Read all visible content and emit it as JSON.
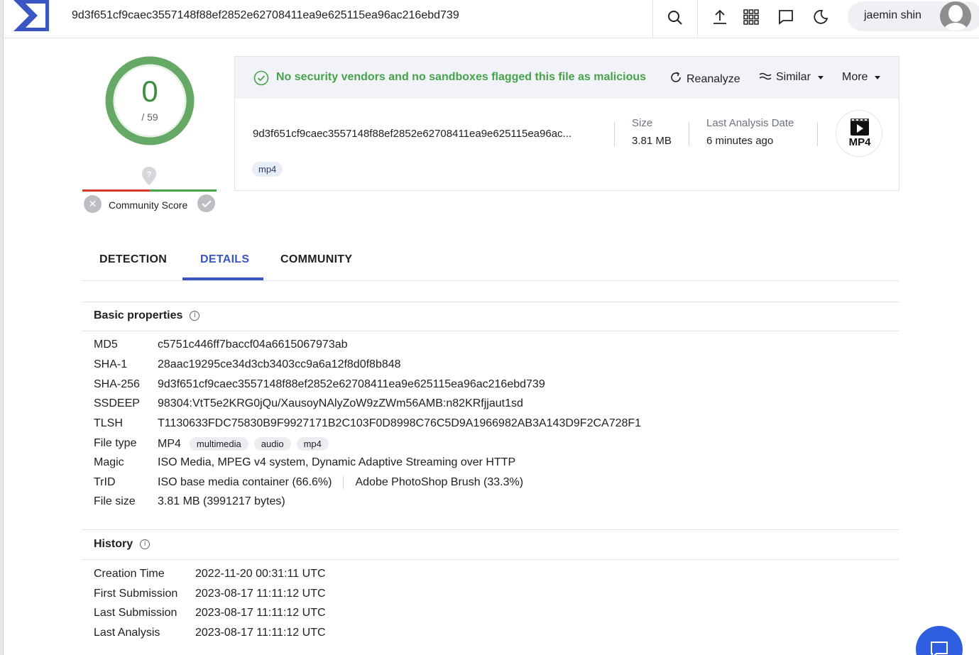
{
  "header": {
    "search_value": "9d3f651cf9caec3557148f88ef2852e62708411ea9e625115ea96ac216ebd739",
    "user_name": "jaemin shin",
    "icons": [
      "logo-sigma-icon",
      "search-icon",
      "upload-icon",
      "apps-grid-icon",
      "chat-icon",
      "dark-mode-icon",
      "avatar"
    ]
  },
  "score": {
    "detections": "0",
    "total": "/ 59",
    "community_label": "Community Score"
  },
  "summary": {
    "status_text": "No security vendors and no sandboxes flagged this file as malicious",
    "reanalyze_label": "Reanalyze",
    "similar_label": "Similar",
    "more_label": "More",
    "hash_short": "9d3f651cf9caec3557148f88ef2852e62708411ea9e625115ea96ac...",
    "size_label": "Size",
    "size_value": "3.81 MB",
    "last_analysis_label": "Last Analysis Date",
    "last_analysis_value": "6 minutes ago",
    "filetype_badge": "MP4",
    "tag": "mp4",
    "status_color": "#46a34a"
  },
  "tabs": [
    {
      "label": "DETECTION",
      "active": false
    },
    {
      "label": "DETAILS",
      "active": true
    },
    {
      "label": "COMMUNITY",
      "active": false
    }
  ],
  "basic_properties": {
    "title": "Basic properties",
    "rows": {
      "md5": {
        "key": "MD5",
        "value": "c5751c446ff7baccf04a6615067973ab"
      },
      "sha1": {
        "key": "SHA-1",
        "value": "28aac19295ce34d3cb3403cc9a6a12f8d0f8b848"
      },
      "sha256": {
        "key": "SHA-256",
        "value": "9d3f651cf9caec3557148f88ef2852e62708411ea9e625115ea96ac216ebd739"
      },
      "ssdeep": {
        "key": "SSDEEP",
        "value": "98304:VtT5e2KRG0jQu/XausoyNAlyZoW9zZWm56AMB:n82KRfjjaut1sd"
      },
      "tlsh": {
        "key": "TLSH",
        "value": "T1130633FDC75830B9F9927171B2C103F0D8998C76C5D9A1966982AB3A143D9F2CA728F1"
      },
      "file_type": {
        "key": "File type",
        "value": "MP4",
        "tags": [
          "multimedia",
          "audio",
          "mp4"
        ]
      },
      "magic": {
        "key": "Magic",
        "value": "ISO Media, MPEG v4 system, Dynamic Adaptive Streaming over HTTP"
      },
      "trid": {
        "key": "TrID",
        "value_1": "ISO base media container (66.6%)",
        "value_2": "Adobe PhotoShop Brush (33.3%)"
      },
      "file_size": {
        "key": "File size",
        "value": "3.81 MB (3991217 bytes)"
      }
    }
  },
  "history": {
    "title": "History",
    "rows": {
      "creation": {
        "key": "Creation Time",
        "value": "2022-11-20 00:31:11 UTC"
      },
      "first_sub": {
        "key": "First Submission",
        "value": "2023-08-17 11:11:12 UTC"
      },
      "last_sub": {
        "key": "Last Submission",
        "value": "2023-08-17 11:11:12 UTC"
      },
      "last_analysis": {
        "key": "Last Analysis",
        "value": "2023-08-17 11:11:12 UTC"
      }
    }
  },
  "colors": {
    "accent": "#3a55c4",
    "clean_green": "#46a34a",
    "malicious_red": "#d33b2c"
  }
}
